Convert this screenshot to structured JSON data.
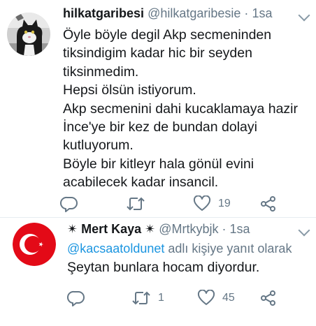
{
  "tweets": [
    {
      "display_name": "hilkatgaribesi",
      "handle": "@hilkatgaribesie",
      "separator": "·",
      "time": "1sa",
      "text_lines": [
        "Öyle böyle degil Akp secmeninden",
        "tiksindigim kadar hic bir seyden",
        "tiksinmedim.",
        "Hepsi ölsün istiyorum.",
        "Akp secmenini dahi kucaklamaya hazir",
        "İnce'ye bir kez de bundan dolayi",
        "kutluyorum.",
        "Böyle bir kitleyr hala gönül evini",
        "acabilecek kadar insancil."
      ],
      "actions": {
        "reply_count": "",
        "retweet_count": "",
        "like_count": "19"
      },
      "icons": [
        "reply-icon",
        "retweet-icon",
        "like-icon",
        "share-icon",
        "caret-down-icon"
      ]
    },
    {
      "display_name": "✴ Mert Kaya ✴",
      "handle": "@Mrtkybjk",
      "separator": "·",
      "time": "1sa",
      "reply_context": {
        "mention": "@kacsaatoldunet",
        "suffix": " adlı kişiye yanıt olarak"
      },
      "text_lines": [
        "Şeytan bunlara hocam diyordur."
      ],
      "actions": {
        "reply_count": "",
        "retweet_count": "1",
        "like_count": "45"
      },
      "icons": [
        "reply-icon",
        "retweet-icon",
        "like-icon",
        "share-icon",
        "caret-down-icon",
        "turkish-flag-avatar"
      ]
    }
  ],
  "colors": {
    "text": "#14171a",
    "secondary": "#657786",
    "link": "#1b95e0",
    "divider": "#e6ecf0",
    "flag_red": "#e30a17"
  }
}
